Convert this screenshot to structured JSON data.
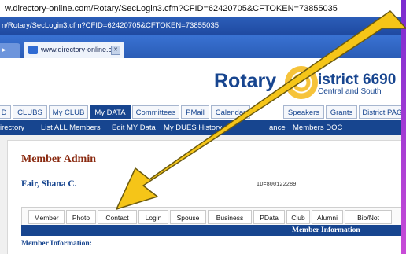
{
  "browser": {
    "address_text": "w.directory-online.com/Rotary/SecLogin3.cfm?CFID=62420705&CFTOKEN=73855035",
    "title_text": "n/Rotary/SecLogin3.cfm?CFID=62420705&CFTOKEN=73855035",
    "tab_label": "www.directory-online.c...",
    "tab_close": "✕"
  },
  "site": {
    "logo_text": "Rotary",
    "district_text": "istrict 6690",
    "district_sub": "Central and South"
  },
  "nav_primary": [
    {
      "label": "D"
    },
    {
      "label": "CLUBS"
    },
    {
      "label": "My CLUB"
    },
    {
      "label": "My DATA"
    },
    {
      "label": "Committees"
    },
    {
      "label": "PMail"
    },
    {
      "label": "Calendar"
    },
    {
      "label": "Speakers"
    },
    {
      "label": "Grants"
    },
    {
      "label": "District PAGE"
    }
  ],
  "nav_secondary": [
    {
      "label": "irectory"
    },
    {
      "label": "List ALL Members"
    },
    {
      "label": "Edit MY Data"
    },
    {
      "label": "My DUES History"
    },
    {
      "label": "ance"
    },
    {
      "label": "Members DOC"
    }
  ],
  "member": {
    "heading": "Member Admin",
    "name": "Fair, Shana C.",
    "id_text": "ID=800122289"
  },
  "member_tabs": [
    {
      "label": "Member"
    },
    {
      "label": "Photo"
    },
    {
      "label": "Contact"
    },
    {
      "label": "Login"
    },
    {
      "label": "Spouse"
    },
    {
      "label": "Business"
    },
    {
      "label": "PData"
    },
    {
      "label": "Club"
    },
    {
      "label": "Alumni"
    },
    {
      "label": "Bio/Not"
    }
  ],
  "section": {
    "bar_title": "Member Information",
    "label": "Member Information:"
  },
  "colors": {
    "rotary_blue": "#17458f",
    "heading_red": "#8a2a10",
    "arrow_yellow": "#f5c518"
  }
}
